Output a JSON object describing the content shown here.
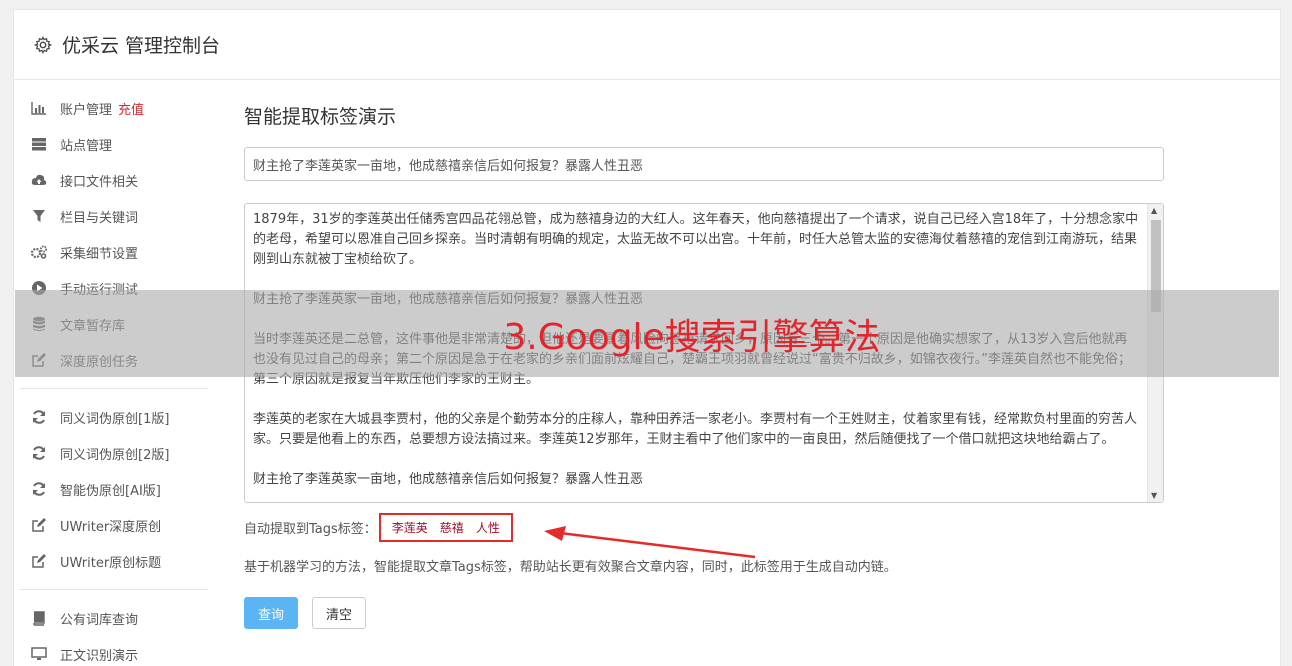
{
  "header": {
    "title": "优采云 管理控制台",
    "icon": "gear-icon"
  },
  "sidebar": {
    "group1": [
      {
        "label": "账户管理",
        "extra": "充值",
        "icon": "bar-chart-icon"
      },
      {
        "label": "站点管理",
        "icon": "server-icon"
      },
      {
        "label": "接口文件相关",
        "icon": "cloud-upload-icon"
      },
      {
        "label": "栏目与关键词",
        "icon": "filter-icon"
      },
      {
        "label": "采集细节设置",
        "icon": "gears-icon"
      },
      {
        "label": "手动运行测试",
        "icon": "play-circle-icon"
      },
      {
        "label": "文章暂存库",
        "icon": "database-icon"
      },
      {
        "label": "深度原创任务",
        "icon": "edit-icon"
      }
    ],
    "group2": [
      {
        "label": "同义词伪原创[1版]",
        "icon": "refresh-icon"
      },
      {
        "label": "同义词伪原创[2版]",
        "icon": "refresh-icon"
      },
      {
        "label": "智能伪原创[AI版]",
        "icon": "refresh-icon"
      },
      {
        "label": "UWriter深度原创",
        "icon": "edit-icon"
      },
      {
        "label": "UWriter原创标题",
        "icon": "edit-icon"
      }
    ],
    "group3": [
      {
        "label": "公有词库查询",
        "icon": "book-icon"
      },
      {
        "label": "正文识别演示",
        "icon": "monitor-icon"
      }
    ]
  },
  "main": {
    "heading": "智能提取标签演示",
    "title_value": "财主抢了李莲英家一亩地，他成慈禧亲信后如何报复？暴露人性丑恶",
    "article": [
      "1879年，31岁的李莲英出任储秀宫四品花翎总管，成为慈禧身边的大红人。这年春天，他向慈禧提出了一个请求，说自己已经入宫18年了，十分想念家中的老母，希望可以恩准自己回乡探亲。当时清朝有明确的规定，太监无故不可以出宫。十年前，时任大总管太监的安德海仗着慈禧的宠信到江南游玩，结果刚到山东就被丁宝桢给砍了。",
      "财主抢了李莲英家一亩地，他成慈禧亲信后如何报复？暴露人性丑恶",
      "当时李莲英还是二总管，这件事他是非常清楚的，但他还是要冒着风险向慈禧请求回乡，原因有三个。第一个原因是他确实想家了，从13岁入宫后他就再也没有见过自己的母亲；第二个原因是急于在老家的乡亲们面前炫耀自己，楚霸王项羽就曾经说过“富贵不归故乡，如锦衣夜行。”李莲英自然也不能免俗；第三个原因就是报复当年欺压他们李家的王财主。",
      "李莲英的老家在大城县李贾村，他的父亲是个勤劳本分的庄稼人，靠种田养活一家老小。李贾村有一个王姓财主，仗着家里有钱，经常欺负村里面的穷苦人家。只要是他看上的东西，总要想方设法搞过来。李莲英12岁那年，王财主看中了他们家中的一亩良田，然后随便找了一个借口就把这块地给霸占了。",
      "财主抢了李莲英家一亩地，他成慈禧亲信后如何报复？暴露人性丑恶"
    ],
    "tags_label": "自动提取到Tags标签：",
    "tags": [
      "李莲英",
      "慈禧",
      "人性"
    ],
    "description": "基于机器学习的方法，智能提取文章Tags标签，帮助站长更有效聚合文章内容，同时，此标签用于生成自动内链。",
    "query_button": "查询",
    "clear_button": "清空"
  },
  "overlay": {
    "text": "3.Google搜索引擎算法"
  },
  "colors": {
    "accent_red": "#e32b2b",
    "primary_blue": "#5bb5f5"
  }
}
